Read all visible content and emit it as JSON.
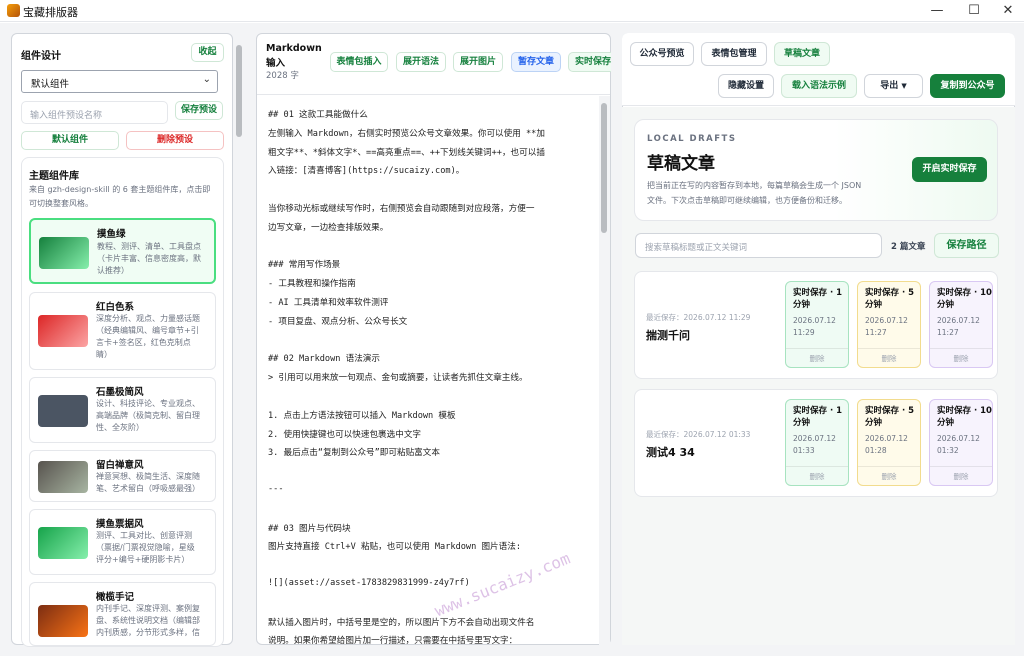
{
  "window": {
    "title": "宝藏排版器"
  },
  "left": {
    "section_title": "组件设计",
    "collapse_label": "收起",
    "select_value": "默认组件",
    "preset_placeholder": "输入组件预设名称",
    "save_preset_label": "保存预设",
    "default_label": "默认组件",
    "delete_preset_label": "删除预设",
    "library_title": "主题组件库",
    "library_desc_1": "来自 gzh-design-skill 的 6 套主题组件库，点击即",
    "library_desc_2": "可切换整套风格。",
    "themes": [
      {
        "name": "摸鱼绿",
        "d1": "教程、测评、清单、工具盘点",
        "d2": "（卡片丰富、信息密度高，默",
        "d3": "认推荐）"
      },
      {
        "name": "红白色系",
        "d1": "深度分析、观点、力量感话题",
        "d2": "（经典编辑风、编号章节+引",
        "d3": "言卡+签名区，红色克制点",
        "d4": "睛）"
      },
      {
        "name": "石墨极简风",
        "d1": "设计、科技评论、专业观点、",
        "d2": "高端品牌（极简克制、留白理",
        "d3": "性、全灰阶）"
      },
      {
        "name": "留白禅意风",
        "d1": "禅意冥想、极简生活、深度随",
        "d2": "笔、艺术留白（呼吸感最强）"
      },
      {
        "name": "摸鱼票据风",
        "d1": "测评、工具对比、创意评测",
        "d2": "（票据/门票视觉隐喻，星级",
        "d3": "评分+编号+硬阴影卡片）"
      },
      {
        "name": "橄榄手记",
        "d1": "内刊手记、深度评测、案例复",
        "d2": "盘、系统性说明文档（编辑部",
        "d3": "内刊质感，分节形式多样，信"
      }
    ]
  },
  "middle": {
    "title_1": "Markdown",
    "title_2": "输入",
    "word_count": "2028 字",
    "buttons": [
      "表情包插入",
      "展开语法",
      "展开图片",
      "暂存文章",
      "实时保存"
    ],
    "lines": [
      "## 01 这款工具能做什么",
      "左侧输入 Markdown，右侧实时预览公众号文章效果。你可以使用 **加",
      "粗文字**、*斜体文字*、==高亮重点==、++下划线关键词++，也可以插",
      "入链接：[清喜博客](https://sucaizy.com)。",
      "",
      "当你移动光标或继续写作时，右侧预览会自动跟随到对应段落，方便一",
      "边写文章，一边检查排版效果。",
      "",
      "### 常用写作场景",
      "- 工具教程和操作指南",
      "- AI 工具清单和效率软件测评",
      "- 项目复盘、观点分析、公众号长文",
      "",
      "## 02 Markdown 语法演示",
      "> 引用可以用来放一句观点、金句或摘要，让读者先抓住文章主线。",
      "",
      "1. 点击上方语法按钮可以插入 Markdown 模板",
      "2. 使用快捷键也可以快速包裹选中文字",
      "3. 最后点击“复制到公众号”即可粘贴富文本",
      "",
      "---",
      "",
      "## 03 图片与代码块",
      "图片支持直接 Ctrl+V 粘贴，也可以使用 Markdown 图片语法:",
      "",
      "![](asset://asset-1783829831999-z4y7rf)",
      "",
      "默认插入图片时，中括号里是空的，所以图片下方不会自动出现文件名",
      "说明。如果你希望给图片加一行描述，只需要在中括号里写文字："
    ],
    "watermark": "www.sucaizy.com"
  },
  "right": {
    "tabs": [
      "公众号预览",
      "表情包管理",
      "草稿文章"
    ],
    "hide_settings": "隐藏设置",
    "load_sample": "载入语法示例",
    "export": "导出",
    "copy_to_wechat": "复制到公众号",
    "eyebrow": "LOCAL DRAFTS",
    "heading": "草稿文章",
    "desc_1": "把当前正在写的内容暂存到本地，每篇草稿会生成一个 JSON",
    "desc_2": "文件。下次点击草稿即可继续编辑，也方便备份和迁移。",
    "realtime_btn": "开启实时保存",
    "search_placeholder": "搜索草稿标题或正文关键词",
    "draft_count": "2 篇文章",
    "save_path": "保存路径",
    "drafts": [
      {
        "recent": "最近保存：2026.07.12 11:29",
        "title": "揣测千问",
        "saves": [
          {
            "t": "实时保存 · 1 分钟",
            "d1": "2026.07.12",
            "d2": "11:29"
          },
          {
            "t": "实时保存 · 5 分钟",
            "d1": "2026.07.12",
            "d2": "11:27"
          },
          {
            "t": "实时保存 · 10分钟",
            "d1": "2026.07.12",
            "d2": "11:27"
          }
        ]
      },
      {
        "recent": "最近保存：2026.07.12 01:33",
        "title": "测试4 34",
        "saves": [
          {
            "t": "实时保存 · 1 分钟",
            "d1": "2026.07.12",
            "d2": "01:33"
          },
          {
            "t": "实时保存 · 5 分钟",
            "d1": "2026.07.12",
            "d2": "01:28"
          },
          {
            "t": "实时保存 · 10分钟",
            "d1": "2026.07.12",
            "d2": "01:32"
          }
        ]
      }
    ],
    "delete_label": "删除"
  },
  "colors": {
    "accent": "#15803d",
    "primary": "#16803c"
  }
}
